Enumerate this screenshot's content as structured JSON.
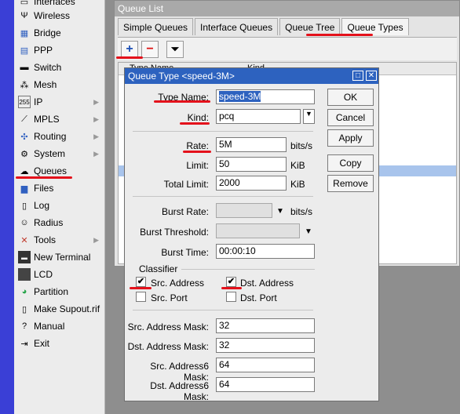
{
  "sidebar": {
    "items": [
      {
        "label": "Interfaces",
        "icon": "interfaces-icon"
      },
      {
        "label": "Wireless",
        "icon": "wireless-icon"
      },
      {
        "label": "Bridge",
        "icon": "bridge-icon"
      },
      {
        "label": "PPP",
        "icon": "ppp-icon"
      },
      {
        "label": "Switch",
        "icon": "switch-icon"
      },
      {
        "label": "Mesh",
        "icon": "mesh-icon"
      },
      {
        "label": "IP",
        "icon": "ip-icon"
      },
      {
        "label": "MPLS",
        "icon": "mpls-icon"
      },
      {
        "label": "Routing",
        "icon": "routing-icon"
      },
      {
        "label": "System",
        "icon": "system-icon"
      },
      {
        "label": "Queues",
        "icon": "queues-icon"
      },
      {
        "label": "Files",
        "icon": "files-icon"
      },
      {
        "label": "Log",
        "icon": "log-icon"
      },
      {
        "label": "Radius",
        "icon": "radius-icon"
      },
      {
        "label": "Tools",
        "icon": "tools-icon"
      },
      {
        "label": "New Terminal",
        "icon": "terminal-icon"
      },
      {
        "label": "LCD",
        "icon": "lcd-icon"
      },
      {
        "label": "Partition",
        "icon": "partition-icon"
      },
      {
        "label": "Make Supout.rif",
        "icon": "supout-icon"
      },
      {
        "label": "Manual",
        "icon": "manual-icon"
      },
      {
        "label": "Exit",
        "icon": "exit-icon"
      }
    ]
  },
  "queue_window": {
    "title": "Queue List",
    "tabs": [
      "Simple Queues",
      "Interface Queues",
      "Queue Tree",
      "Queue Types"
    ],
    "active_tab": "Queue Types",
    "columns": [
      "Type Name",
      "Kind"
    ]
  },
  "dialog": {
    "title": "Queue Type <speed-3M>",
    "type_name_label": "Type Name:",
    "type_name_value": "speed-3M",
    "kind_label": "Kind:",
    "kind_value": "pcq",
    "rate_label": "Rate:",
    "rate_value": "5M",
    "rate_unit": "bits/s",
    "limit_label": "Limit:",
    "limit_value": "50",
    "limit_unit": "KiB",
    "total_limit_label": "Total Limit:",
    "total_limit_value": "2000",
    "total_limit_unit": "KiB",
    "burst_rate_label": "Burst Rate:",
    "burst_rate_unit": "bits/s",
    "burst_threshold_label": "Burst Threshold:",
    "burst_time_label": "Burst Time:",
    "burst_time_value": "00:00:10",
    "classifier_label": "Classifier",
    "src_address_label": "Src. Address",
    "src_address_checked": true,
    "dst_address_label": "Dst. Address",
    "dst_address_checked": true,
    "src_port_label": "Src. Port",
    "src_port_checked": false,
    "dst_port_label": "Dst. Port",
    "dst_port_checked": false,
    "src_mask_label": "Src. Address Mask:",
    "src_mask_value": "32",
    "dst_mask_label": "Dst. Address Mask:",
    "dst_mask_value": "32",
    "src6_mask_label": "Src. Address6 Mask:",
    "src6_mask_value": "64",
    "dst6_mask_label": "Dst. Address6 Mask:",
    "dst6_mask_value": "64",
    "buttons": {
      "ok": "OK",
      "cancel": "Cancel",
      "apply": "Apply",
      "copy": "Copy",
      "remove": "Remove"
    }
  },
  "colors": {
    "accent": "#2d62bf",
    "highlight": "#e4111b",
    "sidebar_strip": "#3a3fd6"
  }
}
